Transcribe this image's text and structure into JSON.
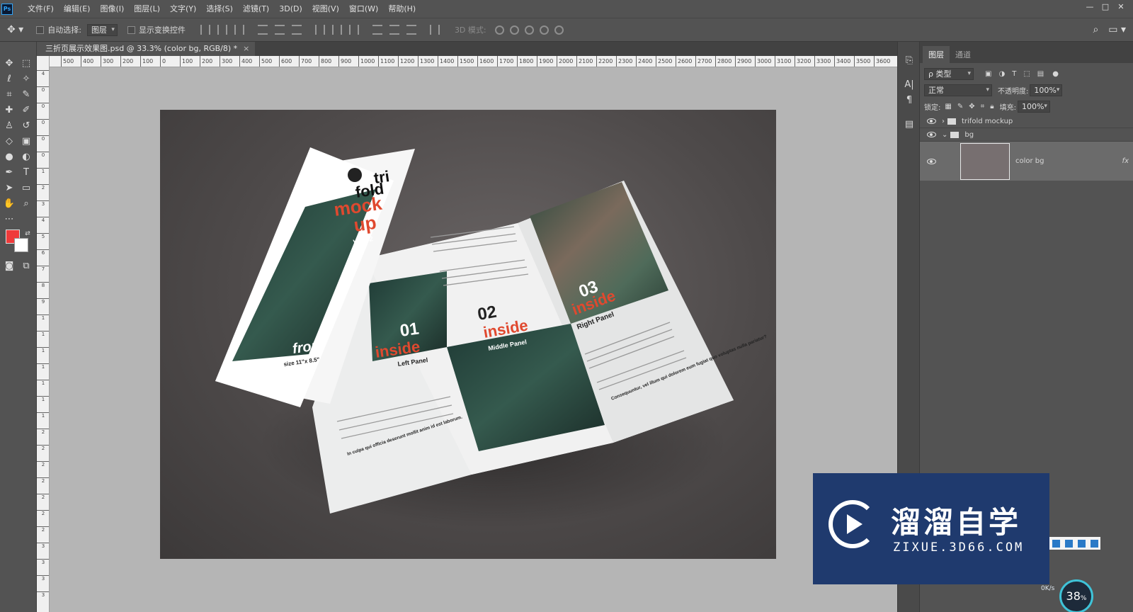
{
  "app": {
    "logo": "Ps"
  },
  "menu": [
    "文件(F)",
    "编辑(E)",
    "图像(I)",
    "图层(L)",
    "文字(Y)",
    "选择(S)",
    "滤镜(T)",
    "3D(D)",
    "视图(V)",
    "窗口(W)",
    "帮助(H)"
  ],
  "window_controls": [
    "—",
    "□",
    "✕"
  ],
  "options": {
    "auto_select_label": "自动选择:",
    "auto_select_value": "图层",
    "show_transform_label": "显示变换控件",
    "mode3d_label": "3D 模式:"
  },
  "document": {
    "tab_title": "三折页展示效果图.psd @ 33.3% (color bg, RGB/8) *",
    "close": "×"
  },
  "ruler_h": [
    "500",
    "400",
    "300",
    "200",
    "100",
    "0",
    "100",
    "200",
    "300",
    "400",
    "500",
    "600",
    "700",
    "800",
    "900",
    "1000",
    "1100",
    "1200",
    "1300",
    "1400",
    "1500",
    "1600",
    "1700",
    "1800",
    "1900",
    "2000",
    "2100",
    "2200",
    "2300",
    "2400",
    "2500",
    "2600",
    "2700",
    "2800",
    "2900",
    "3000",
    "3100",
    "3200",
    "3300",
    "3400",
    "3500",
    "3600"
  ],
  "ruler_v": [
    "4",
    "0",
    "0",
    "0",
    "0",
    "0",
    "1",
    "2",
    "3",
    "4",
    "5",
    "6",
    "7",
    "8",
    "9",
    "1",
    "1",
    "1",
    "1",
    "1",
    "1",
    "1",
    "2",
    "2",
    "2",
    "2",
    "2",
    "2",
    "2",
    "3",
    "3",
    "3",
    "3"
  ],
  "brochure": {
    "front_title_1": "tri",
    "front_title_2": "fold",
    "front_title_3": "mock",
    "front_title_4": "up",
    "front_vol": "vol.02",
    "front_label": "front",
    "front_size": "size 11\"x 8.5\"",
    "panel1_num": "01",
    "panel1_word": "inside",
    "panel1_name": "Left Panel",
    "panel2_num": "02",
    "panel2_word": "inside",
    "panel2_name": "Middle Panel",
    "panel3_num": "03",
    "panel3_word": "inside",
    "panel3_name": "Right Panel",
    "left_bold": "In culpa qui officia deserunt mollit anim id est laborum.",
    "right_bold": "Consequuntur, vel illum qui dolorem eum fugiat quo voluptas nulla pariatur?"
  },
  "layers_panel": {
    "tabs": [
      "图层",
      "通道"
    ],
    "filter_label": "ρ 类型",
    "blend_mode": "正常",
    "opacity_label": "不透明度:",
    "opacity_value": "100%",
    "lock_label": "锁定:",
    "fill_label": "填充:",
    "fill_value": "100%",
    "layers": [
      {
        "name": "trifold mockup",
        "type": "group",
        "expanded": false
      },
      {
        "name": "bg",
        "type": "group",
        "expanded": true
      },
      {
        "name": "color bg",
        "type": "layer",
        "selected": true,
        "fx": "fx"
      }
    ]
  },
  "colors": {
    "foreground": "#ef3a3a",
    "background": "#ffffff",
    "accent": "#e0492f",
    "layer_thumb": "#776f70"
  },
  "watermark": {
    "cn": "溜溜自学",
    "en": "ZIXUE.3D66.COM"
  },
  "speed_meter": {
    "value": "38",
    "unit": "%",
    "rate": "0K/s"
  }
}
